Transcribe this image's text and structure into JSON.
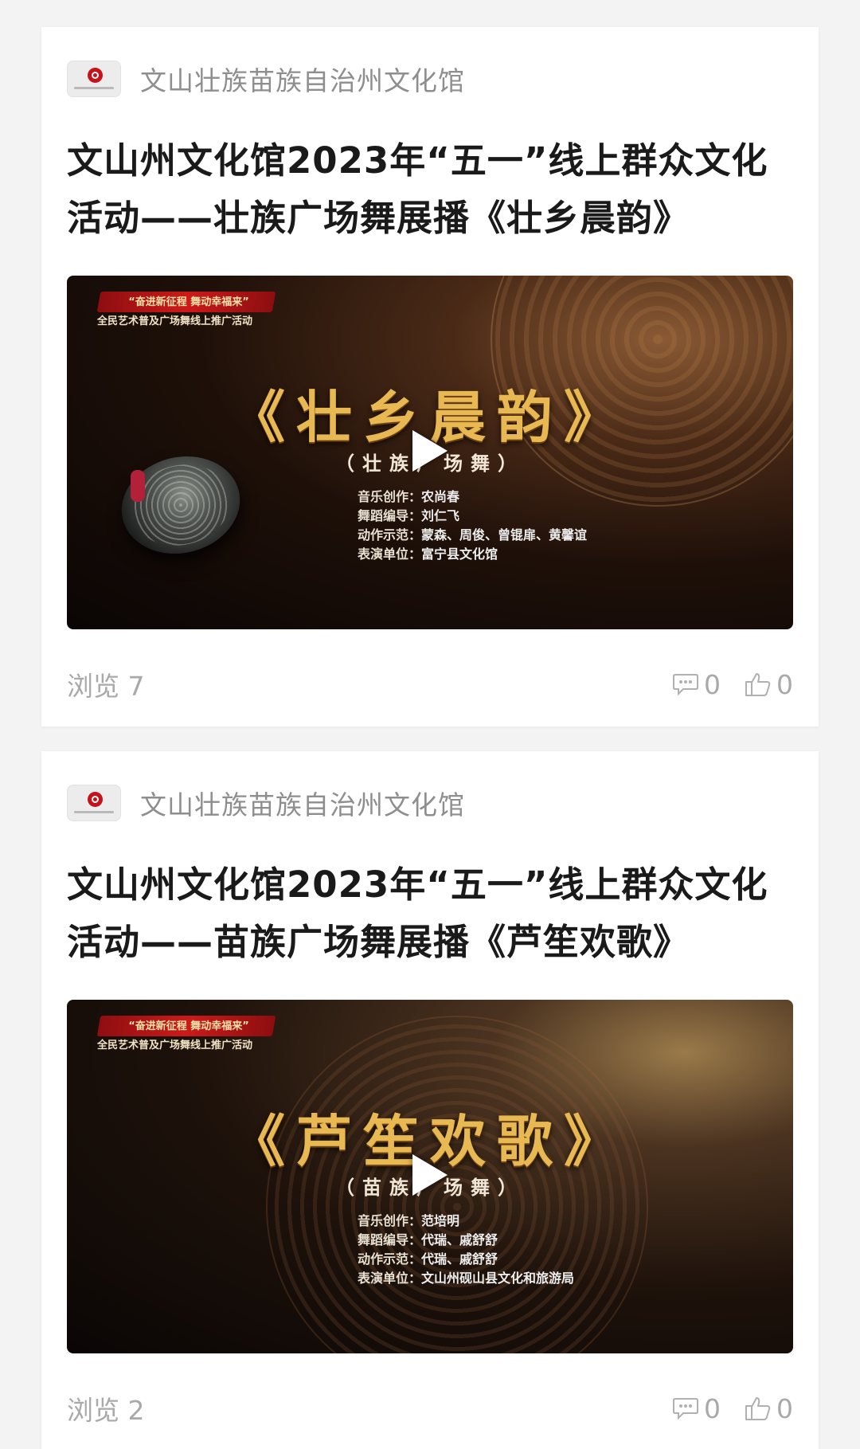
{
  "articles": [
    {
      "source": "文山壮族苗族自治州文化馆",
      "title": "文山州文化馆2023年“五一”线上群众文化活动——壮族广场舞展播《壮乡晨韵》",
      "video": {
        "slogan": "“奋进新征程 舞动幸福来”",
        "subslogan": "全民艺术普及广场舞线上推广活动",
        "show_title": "《壮乡晨韵》",
        "show_sub": "（壮族广场舞）",
        "credits": [
          {
            "label": "音乐创作：",
            "value": "农尚春"
          },
          {
            "label": "舞蹈编导：",
            "value": "刘仁飞"
          },
          {
            "label": "动作示范：",
            "value": "蒙森、周俊、曾锟扉、黄馨谊"
          },
          {
            "label": "表演单位：",
            "value": "富宁县文化馆"
          }
        ]
      },
      "views_label": "浏览 7",
      "comments": "0",
      "likes": "0"
    },
    {
      "source": "文山壮族苗族自治州文化馆",
      "title": "文山州文化馆2023年“五一”线上群众文化活动——苗族广场舞展播《芦笙欢歌》",
      "video": {
        "slogan": "“奋进新征程 舞动幸福来”",
        "subslogan": "全民艺术普及广场舞线上推广活动",
        "show_title": "《芦笙欢歌》",
        "show_sub": "（苗族广场舞）",
        "credits": [
          {
            "label": "音乐创作：",
            "value": "范培明"
          },
          {
            "label": "舞蹈编导：",
            "value": "代瑞、戚舒舒"
          },
          {
            "label": "动作示范：",
            "value": "代瑞、戚舒舒"
          },
          {
            "label": "表演单位：",
            "value": "文山州砚山县文化和旅游局"
          }
        ]
      },
      "views_label": "浏览 2",
      "comments": "0",
      "likes": "0"
    }
  ],
  "icons": {
    "comment": "comment-bubble-icon",
    "like": "thumbs-up-icon",
    "play": "play-icon"
  }
}
